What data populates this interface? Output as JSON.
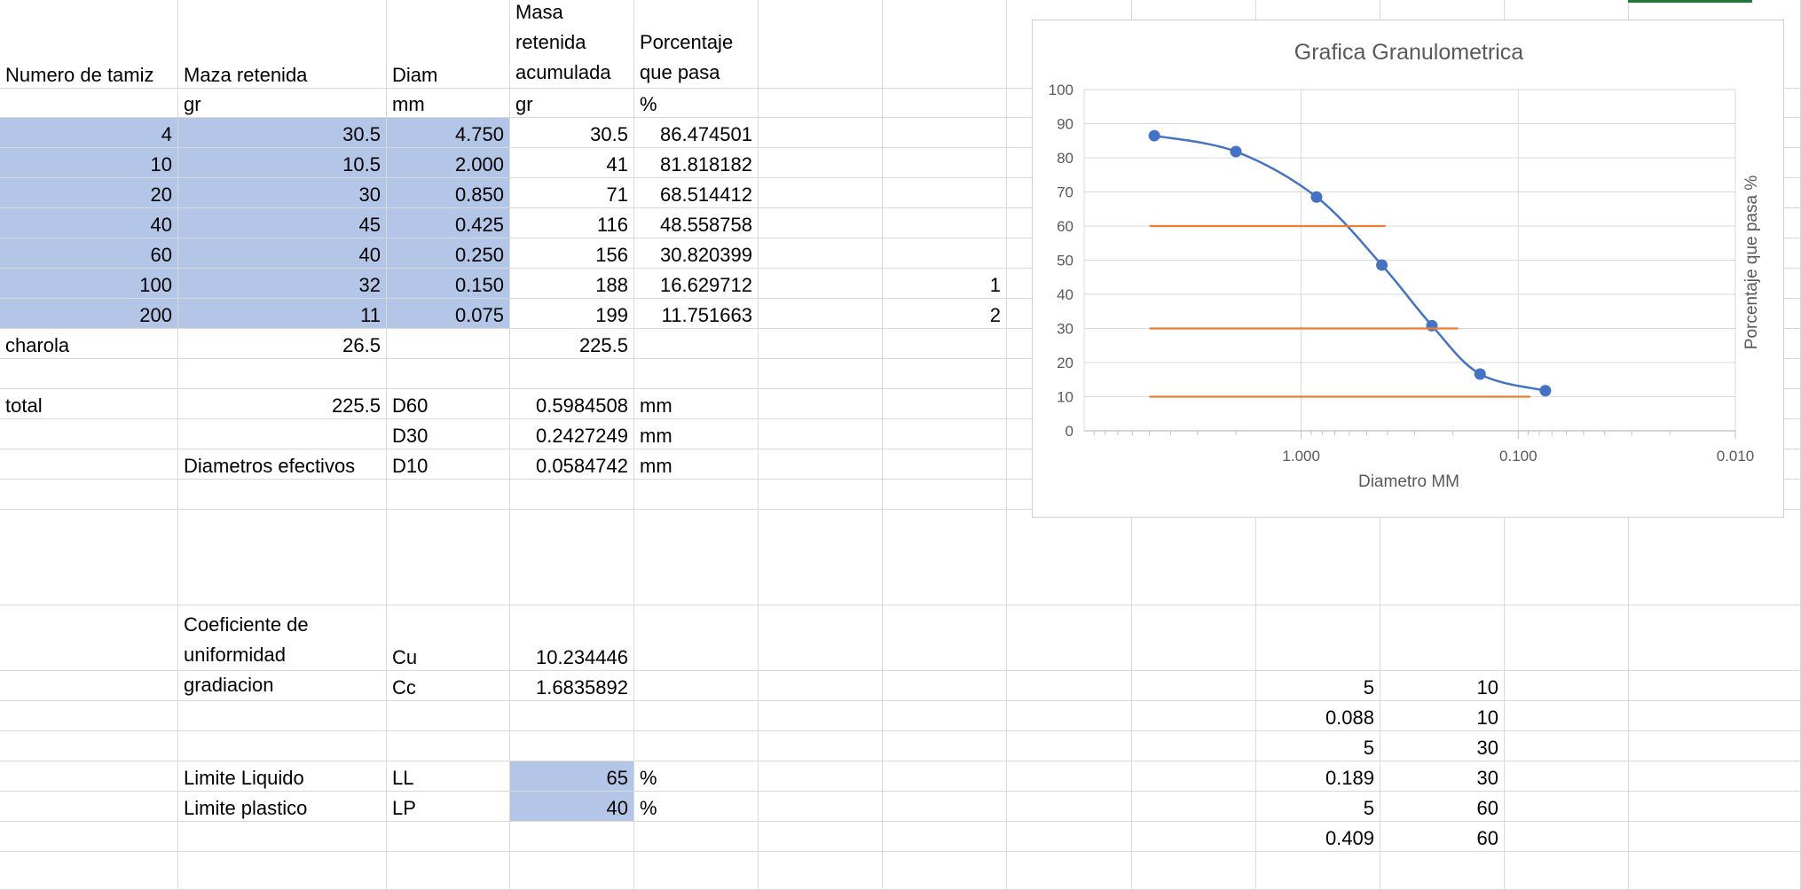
{
  "sheet": {
    "header": {
      "tamiz": "Numero de tamiz",
      "maza": "Maza retenida",
      "diam": "Diam",
      "masa_acum": "Masa retenida acumulada",
      "porcentaje": "Porcentaje que pasa"
    },
    "units": {
      "maza": "gr",
      "diam": "mm",
      "masa_acum": "gr",
      "porcentaje": "%"
    },
    "rows": [
      {
        "tamiz": "4",
        "maza": "30.5",
        "diam": "4.750",
        "acum": "30.5",
        "pasa": "86.474501",
        "extra": ""
      },
      {
        "tamiz": "10",
        "maza": "10.5",
        "diam": "2.000",
        "acum": "41",
        "pasa": "81.818182",
        "extra": ""
      },
      {
        "tamiz": "20",
        "maza": "30",
        "diam": "0.850",
        "acum": "71",
        "pasa": "68.514412",
        "extra": ""
      },
      {
        "tamiz": "40",
        "maza": "45",
        "diam": "0.425",
        "acum": "116",
        "pasa": "48.558758",
        "extra": ""
      },
      {
        "tamiz": "60",
        "maza": "40",
        "diam": "0.250",
        "acum": "156",
        "pasa": "30.820399",
        "extra": ""
      },
      {
        "tamiz": "100",
        "maza": "32",
        "diam": "0.150",
        "acum": "188",
        "pasa": "16.629712",
        "extra": "1"
      },
      {
        "tamiz": "200",
        "maza": "11",
        "diam": "0.075",
        "acum": "199",
        "pasa": "11.751663",
        "extra": "2"
      }
    ],
    "charola": {
      "label": "charola",
      "maza": "26.5",
      "acum": "225.5"
    },
    "total": {
      "label": "total",
      "value": "225.5"
    },
    "d60": {
      "label": "D60",
      "value": "0.5984508",
      "unit": "mm"
    },
    "d30": {
      "label": "D30",
      "value": "0.2427249",
      "unit": "mm"
    },
    "d10": {
      "label": "D10",
      "value": "0.0584742",
      "unit": "mm",
      "desc": "Diametros efectivos"
    },
    "cu": {
      "desc": "Coeficiente de uniformidad",
      "label": "Cu",
      "value": "10.234446"
    },
    "cc": {
      "desc": "Coeficiente de gradiacion",
      "label": "Cc",
      "value": "1.6835892"
    },
    "ll": {
      "desc": "Limite Liquido",
      "label": "LL",
      "value": "65",
      "unit": "%"
    },
    "lp": {
      "desc": "Limite plastico",
      "label": "LP",
      "value": "40",
      "unit": "%"
    },
    "aux": [
      [
        "5",
        "10"
      ],
      [
        "0.088",
        "10"
      ],
      [
        "5",
        "30"
      ],
      [
        "0.189",
        "30"
      ],
      [
        "5",
        "60"
      ],
      [
        "0.409",
        "60"
      ]
    ]
  },
  "chart_data": {
    "type": "scatter",
    "title": "Grafica Granulometrica",
    "xlabel": "Diametro MM",
    "ylabel": "Porcentaje que pasa %",
    "x_scale": "log",
    "x_reversed": true,
    "xlim": [
      10,
      0.01
    ],
    "ylim": [
      0,
      100
    ],
    "x_ticks": [
      "1.000",
      "0.100",
      "0.010"
    ],
    "y_ticks": [
      "0",
      "10",
      "20",
      "30",
      "40",
      "50",
      "60",
      "70",
      "80",
      "90",
      "100"
    ],
    "grid": true,
    "series": [
      {
        "x": [
          4.75,
          2.0,
          0.85,
          0.425,
          0.25,
          0.15,
          0.075
        ],
        "y": [
          86.474501,
          81.818182,
          68.514412,
          48.558758,
          30.820399,
          16.629712,
          11.751663
        ],
        "color": "#4472c4",
        "style": "smooth-line-markers"
      },
      {
        "x": [
          5,
          0.088
        ],
        "y": [
          10,
          10
        ],
        "color": "#ed7d31",
        "style": "line"
      },
      {
        "x": [
          5,
          0.189
        ],
        "y": [
          30,
          30
        ],
        "color": "#ed7d31",
        "style": "line"
      },
      {
        "x": [
          5,
          0.409
        ],
        "y": [
          60,
          60
        ],
        "color": "#ed7d31",
        "style": "line"
      }
    ]
  }
}
